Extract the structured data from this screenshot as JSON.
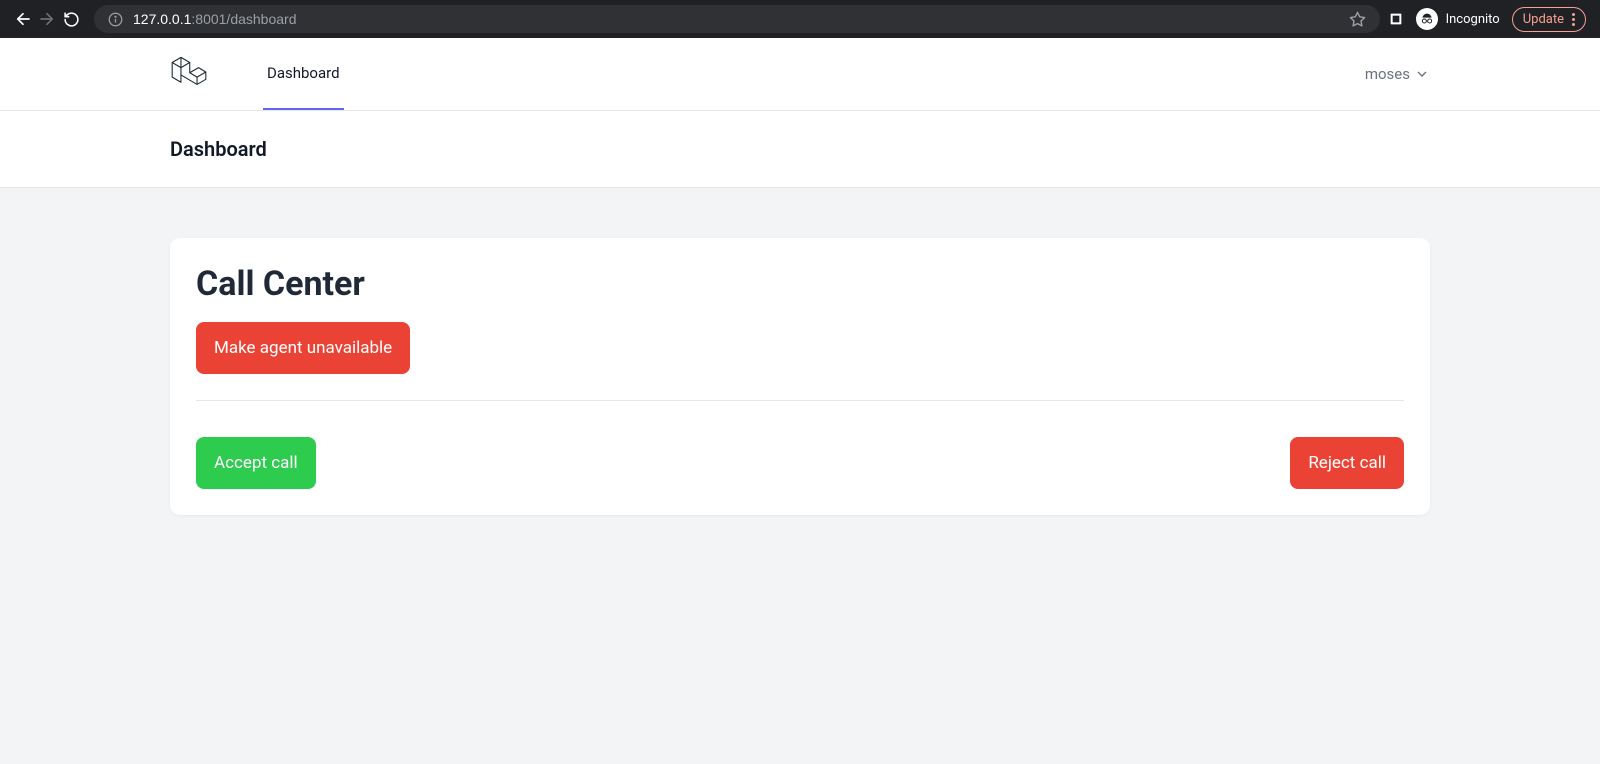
{
  "browser": {
    "url_host": "127.0.0.1",
    "url_port_path": ":8001/dashboard",
    "incognito_label": "Incognito",
    "update_label": "Update"
  },
  "nav": {
    "tab_dashboard": "Dashboard",
    "user_name": "moses"
  },
  "header": {
    "title": "Dashboard"
  },
  "card": {
    "title": "Call Center",
    "make_unavailable_label": "Make agent unavailable",
    "accept_label": "Accept call",
    "reject_label": "Reject call"
  }
}
